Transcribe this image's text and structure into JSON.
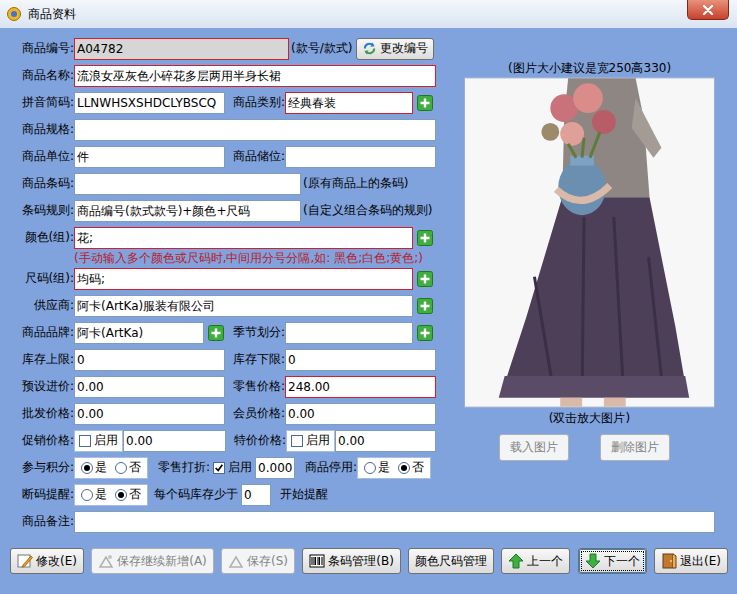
{
  "window": {
    "title": "商品资料"
  },
  "code": {
    "label": "商品编号:",
    "value": "A04782",
    "required": true,
    "disabled": true,
    "note": "(款号/款式)",
    "button": "更改编号"
  },
  "name": {
    "label": "商品名称:",
    "value": "流浪女巫灰色小碎花多层两用半身长裙",
    "required": true
  },
  "pinyin": {
    "label": "拼音简码:",
    "value": "LLNWHSXSHDCLYBSCQ",
    "required": false
  },
  "category": {
    "label": "商品类别:",
    "value": "经典春装",
    "required": true
  },
  "spec": {
    "label": "商品规格:",
    "value": "",
    "required": false
  },
  "unit": {
    "label": "商品单位:",
    "value": "件",
    "required": false
  },
  "location": {
    "label": "商品储位:",
    "value": "",
    "required": false
  },
  "barcode": {
    "label": "商品条码:",
    "value": "",
    "required": false,
    "note": "(原有商品上的条码)"
  },
  "barcodeRule": {
    "label": "条码规则:",
    "value": "商品编号(款式款号)+颜色+尺码",
    "required": false,
    "note": "(自定义组合条码的规则)"
  },
  "colors": {
    "label": "颜色(组):",
    "value": "花;",
    "required": true
  },
  "separatorHint": "(手动输入多个颜色或尺码时,中间用分号分隔,如: 黑色;白色;黄色;)",
  "sizes": {
    "label": "尺码(组):",
    "value": "均码;",
    "required": true
  },
  "supplier": {
    "label": "供应商:",
    "value": "阿卡(ArtKa)服装有限公司",
    "required": false
  },
  "brand": {
    "label": "商品品牌:",
    "value": "阿卡(ArtKa)",
    "required": false
  },
  "season": {
    "label": "季节划分:",
    "value": "",
    "required": false
  },
  "stockMax": {
    "label": "库存上限:",
    "value": "0",
    "required": false
  },
  "stockMin": {
    "label": "库存下限:",
    "value": "0",
    "required": false
  },
  "costPrice": {
    "label": "预设进价:",
    "value": "0.00",
    "required": false
  },
  "retailPrice": {
    "label": "零售价格:",
    "value": "248.00",
    "required": true
  },
  "wholesalePrice": {
    "label": "批发价格:",
    "value": "0.00",
    "required": false
  },
  "memberPrice": {
    "label": "会员价格:",
    "value": "0.00",
    "required": false
  },
  "promoPrice": {
    "label": "促销价格:",
    "check": "启用",
    "checked": false,
    "value": "0.00"
  },
  "specialPrice": {
    "label": "特价价格:",
    "check": "启用",
    "checked": false,
    "value": "0.00"
  },
  "points": {
    "label": "参与积分:",
    "options": [
      {
        "label": "是",
        "selected": true
      },
      {
        "label": "否",
        "selected": false
      }
    ]
  },
  "retailDiscount": {
    "label": "零售打折:",
    "check": "启用",
    "checked": true,
    "value": "0.000"
  },
  "stopped": {
    "label": "商品停用:",
    "options": [
      {
        "label": "是",
        "selected": false
      },
      {
        "label": "否",
        "selected": true
      }
    ]
  },
  "sizeAlert": {
    "label": "断码提醒:",
    "options": [
      {
        "label": "是",
        "selected": false
      },
      {
        "label": "否",
        "selected": true
      }
    ],
    "prefix": "每个码库存少于",
    "value": "0",
    "suffix": "开始提醒"
  },
  "remark": {
    "label": "商品备注:",
    "value": ""
  },
  "image": {
    "hint": "(图片大小建议是宽250高330)",
    "caption": "(双击放大图片)",
    "buttons": [
      {
        "label": "载入图片",
        "disabled": true
      },
      {
        "label": "删除图片",
        "disabled": true
      }
    ]
  },
  "toolbar": [
    {
      "label": "修改(E)",
      "disabled": false,
      "focused": false
    },
    {
      "label": "保存继续新增(A)",
      "disabled": true,
      "focused": false
    },
    {
      "label": "保存(S)",
      "disabled": true,
      "focused": false
    },
    {
      "label": "条码管理(B)",
      "disabled": false,
      "focused": false
    },
    {
      "label": "颜色尺码管理",
      "disabled": false,
      "focused": false
    },
    {
      "label": "上一个",
      "disabled": false,
      "focused": false
    },
    {
      "label": "下一个",
      "disabled": false,
      "focused": true
    },
    {
      "label": "退出(E)",
      "disabled": false,
      "focused": false
    }
  ]
}
